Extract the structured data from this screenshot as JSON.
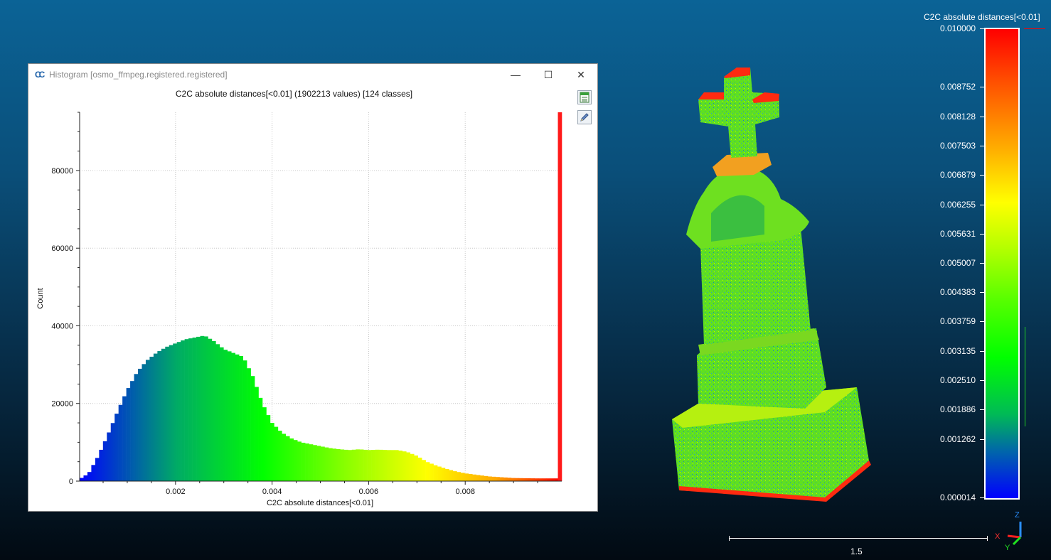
{
  "dialog": {
    "title": "Histogram [osmo_ffmpeg.registered.registered]",
    "minimize_glyph": "—",
    "maximize_glyph": "☐",
    "close_glyph": "✕",
    "tools": [
      "export-csv-icon",
      "edit-icon"
    ]
  },
  "histogram_title": "C2C absolute distances[<0.01] (1902213 values)  [124 classes]",
  "chart_data": {
    "type": "bar",
    "title": "C2C absolute distances[<0.01] (1902213 values)  [124 classes]",
    "xlabel": "C2C absolute distances[<0.01]",
    "ylabel": "Count",
    "xlim": [
      1.4e-05,
      0.01
    ],
    "ylim": [
      0,
      95000
    ],
    "xticks": [
      0.002,
      0.004,
      0.006,
      0.008
    ],
    "xtick_labels": [
      "0.002",
      "0.004",
      "0.006",
      "0.008"
    ],
    "yticks": [
      0,
      20000,
      40000,
      60000,
      80000
    ],
    "ytick_labels": [
      "0",
      "20000",
      "40000",
      "60000",
      "80000"
    ],
    "grid": true,
    "classes": 124,
    "profile_x": [
      1.4e-05,
      0.0002,
      0.0004,
      0.0006,
      0.0008,
      0.001,
      0.0012,
      0.0014,
      0.0016,
      0.0018,
      0.002,
      0.0022,
      0.0024,
      0.0026,
      0.0028,
      0.003,
      0.0032,
      0.0034,
      0.0036,
      0.0038,
      0.004,
      0.0042,
      0.0044,
      0.0046,
      0.0048,
      0.005,
      0.0052,
      0.0054,
      0.0056,
      0.0058,
      0.006,
      0.0062,
      0.0064,
      0.0066,
      0.0068,
      0.007,
      0.0072,
      0.0074,
      0.0076,
      0.0078,
      0.008,
      0.0085,
      0.009,
      0.0095,
      0.0099,
      0.01
    ],
    "profile_y": [
      500,
      2000,
      6500,
      12000,
      18000,
      23500,
      28000,
      31000,
      33000,
      34500,
      35500,
      36500,
      37000,
      37500,
      36000,
      34000,
      33000,
      32000,
      27000,
      20000,
      15000,
      12500,
      11000,
      10000,
      9500,
      9000,
      8500,
      8200,
      8000,
      8200,
      8000,
      8100,
      8000,
      8000,
      7500,
      6500,
      5000,
      4000,
      3200,
      2500,
      2000,
      1200,
      800,
      700,
      700,
      95000
    ]
  },
  "colorbar": {
    "title": "C2C absolute distances[<0.01]",
    "labels": [
      "0.010000",
      "0.008752",
      "0.008128",
      "0.007503",
      "0.006879",
      "0.006255",
      "0.005631",
      "0.005007",
      "0.004383",
      "0.003759",
      "0.003135",
      "0.002510",
      "0.001886",
      "0.001262",
      "0.000014"
    ],
    "min": 1.4e-05,
    "max": 0.01
  },
  "scale_bar": {
    "label": "1.5"
  },
  "axes_gizmo": {
    "z": "Z",
    "x": "X",
    "y": "Y"
  },
  "colors": {
    "background_top": "#0b6396",
    "background_bottom": "#020a12",
    "icon_blue": "#1b5fa8"
  }
}
